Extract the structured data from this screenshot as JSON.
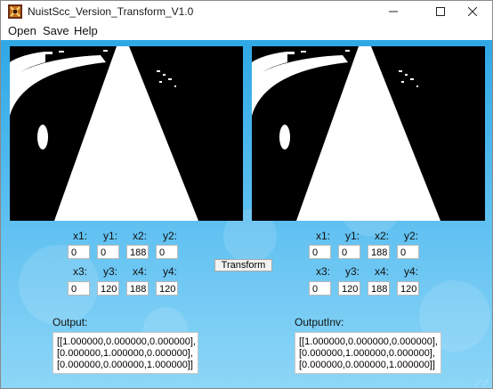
{
  "window": {
    "title": "NuistScc_Version_Transform_V1.0"
  },
  "menu": {
    "items": [
      "Open",
      "Save",
      "Help"
    ]
  },
  "controls": {
    "icons": {
      "minimize": "minimize-icon",
      "maximize": "maximize-icon",
      "close": "close-icon"
    }
  },
  "left": {
    "labels": {
      "x1": "x1:",
      "y1": "y1:",
      "x2": "x2:",
      "y2": "y2:",
      "x3": "x3:",
      "y3": "y3:",
      "x4": "x4:",
      "y4": "y4:"
    },
    "values": {
      "x1": "0",
      "y1": "0",
      "x2": "188",
      "y2": "0",
      "x3": "0",
      "y3": "120",
      "x4": "188",
      "y4": "120"
    }
  },
  "right": {
    "labels": {
      "x1": "x1:",
      "y1": "y1:",
      "x2": "x2:",
      "y2": "y2:",
      "x3": "x3:",
      "y3": "y3:",
      "x4": "x4:",
      "y4": "y4:"
    },
    "values": {
      "x1": "0",
      "y1": "0",
      "x2": "188",
      "y2": "0",
      "x3": "0",
      "y3": "120",
      "x4": "188",
      "y4": "120"
    }
  },
  "transform_button": "Transform",
  "output": {
    "label": "Output:",
    "text": "[[1.000000,0.000000,0.000000],\n[0.000000,1.000000,0.000000],\n[0.000000,0.000000,1.000000]]"
  },
  "output_inv": {
    "label": "OutputInv:",
    "text": "[[1.000000,0.000000,0.000000],\n[0.000000,1.000000,0.000000],\n[0.000000,0.000000,1.000000]]"
  }
}
